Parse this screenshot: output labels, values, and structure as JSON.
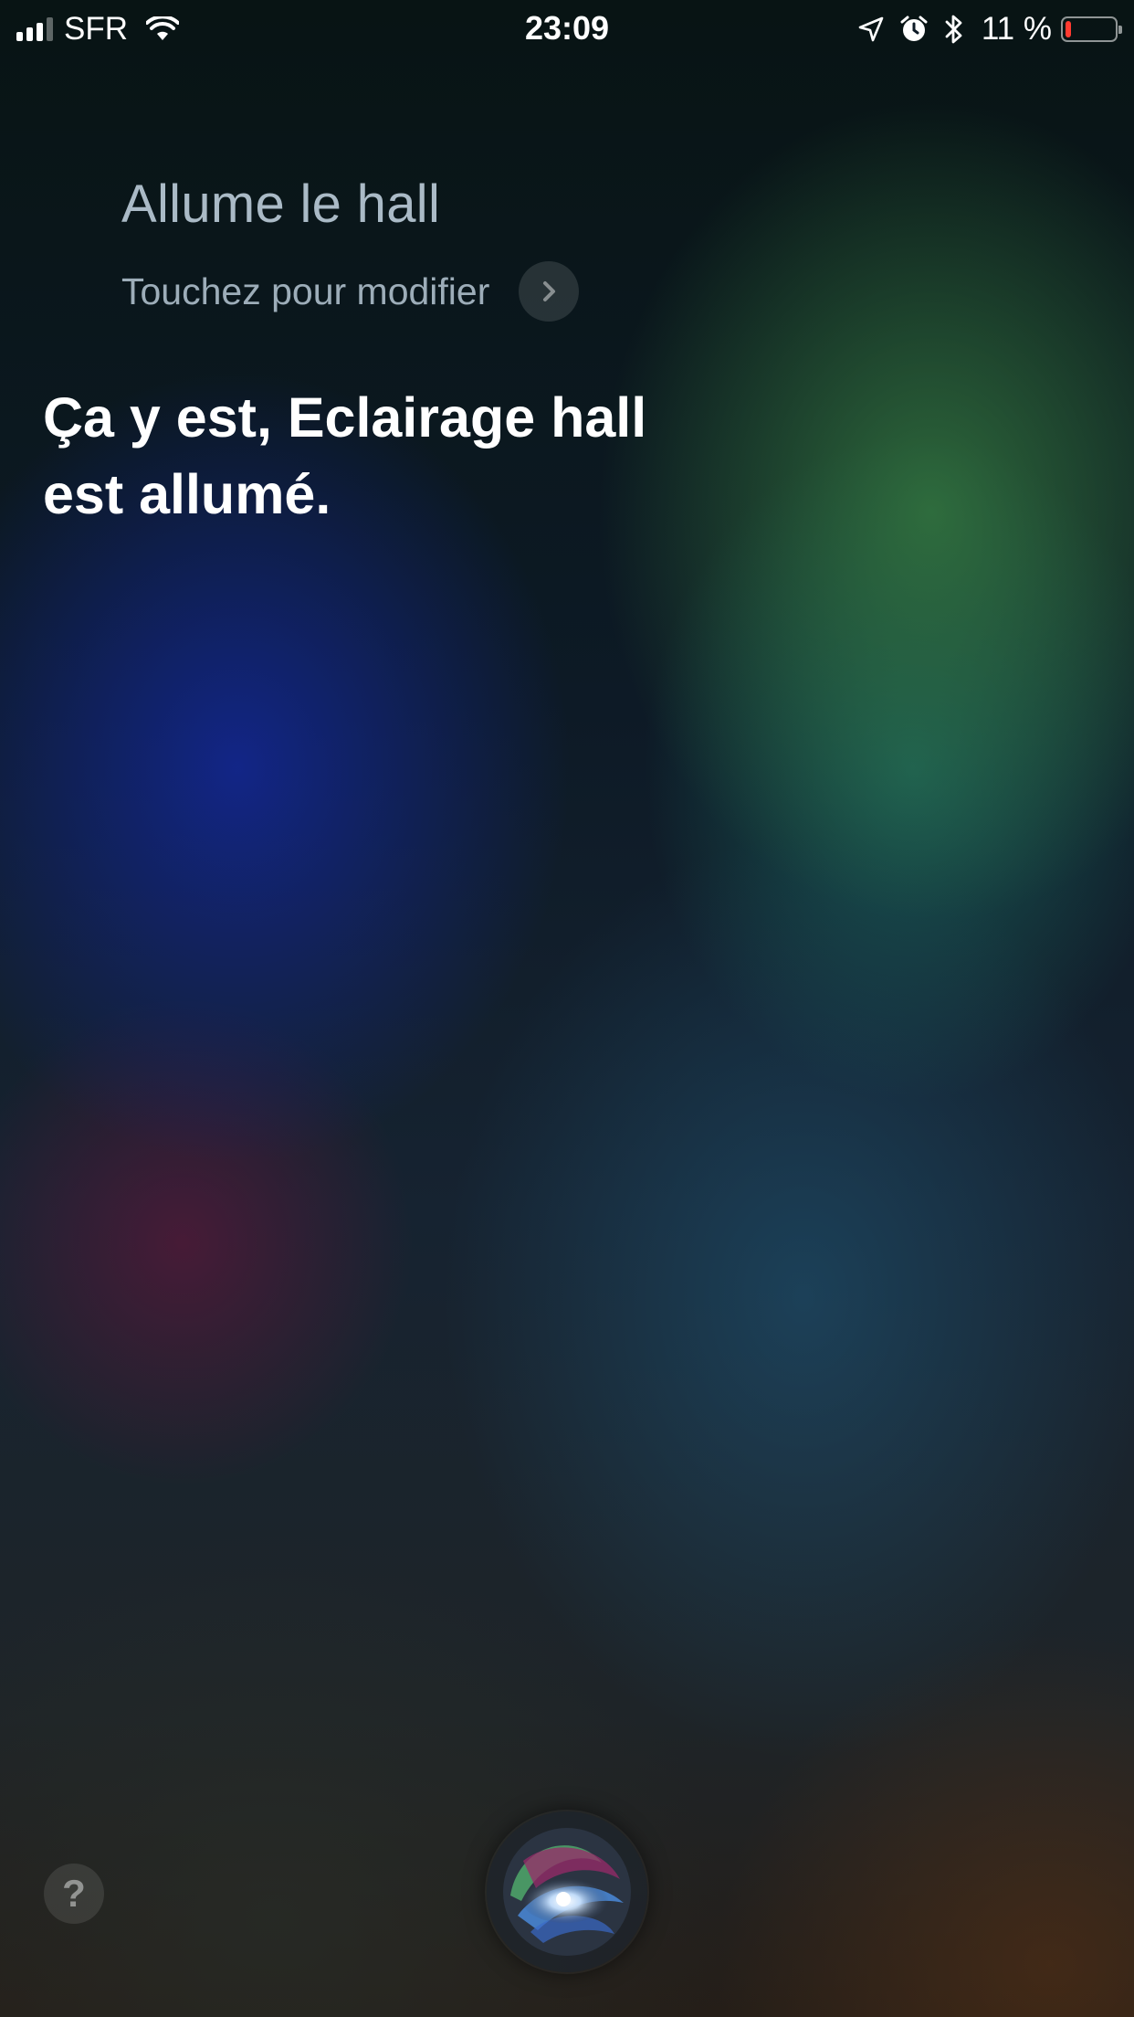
{
  "status_bar": {
    "carrier": "SFR",
    "time": "23:09",
    "battery_percent_label": "11 %",
    "battery_level": 0.11,
    "icons": [
      "signal-icon",
      "wifi-icon",
      "location-arrow-icon",
      "alarm-icon",
      "bluetooth-icon",
      "battery-icon"
    ],
    "battery_color": "#ff3b30"
  },
  "siri": {
    "query": "Allume le hall",
    "edit_hint": "Touchez pour modifier",
    "response": "Ça y est, Eclairage hall est allumé."
  },
  "controls": {
    "help_label": "?",
    "orb_icon": "siri-orb-icon"
  }
}
